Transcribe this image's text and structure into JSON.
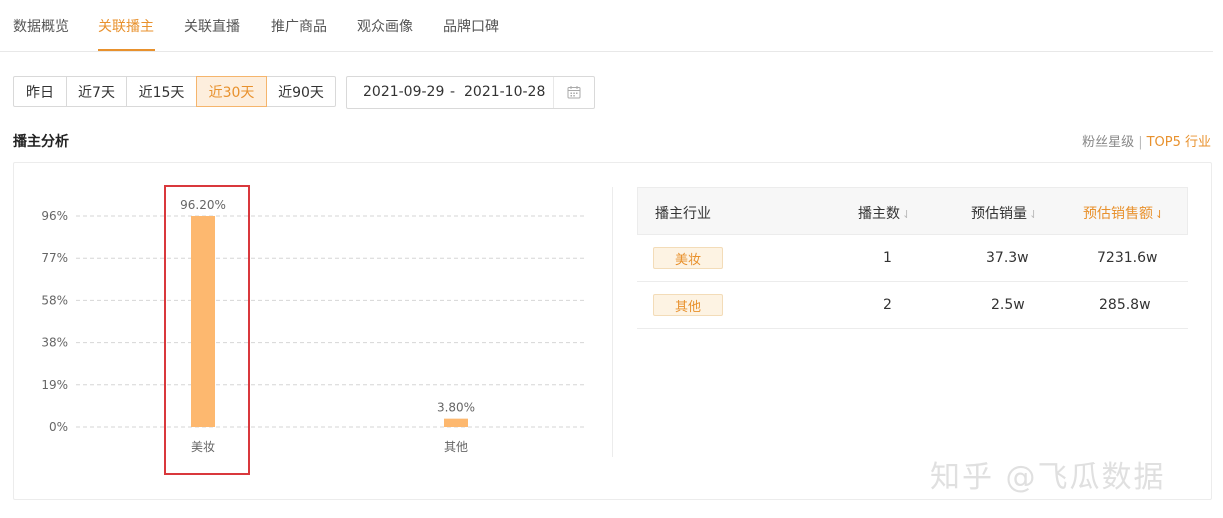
{
  "tabs": [
    {
      "label": "数据概览",
      "active": false
    },
    {
      "label": "关联播主",
      "active": true
    },
    {
      "label": "关联直播",
      "active": false
    },
    {
      "label": "推广商品",
      "active": false
    },
    {
      "label": "观众画像",
      "active": false
    },
    {
      "label": "品牌口碑",
      "active": false
    }
  ],
  "ranges": [
    {
      "label": "昨日",
      "active": false
    },
    {
      "label": "近7天",
      "active": false
    },
    {
      "label": "近15天",
      "active": false
    },
    {
      "label": "近30天",
      "active": true
    },
    {
      "label": "近90天",
      "active": false
    }
  ],
  "date_range": {
    "start": "2021-09-29",
    "separator": "-",
    "end": "2021-10-28"
  },
  "section": {
    "title": "播主分析",
    "link_muted": "粉丝星级",
    "link_sep": "|",
    "link_active": "TOP5 行业"
  },
  "chart_data": {
    "type": "bar",
    "categories": [
      "美妆",
      "其他"
    ],
    "values": [
      96.2,
      3.8
    ],
    "data_labels": [
      "96.20%",
      "3.80%"
    ],
    "y_ticks": [
      "96%",
      "77%",
      "58%",
      "38%",
      "19%",
      "0%"
    ],
    "ylim": [
      0,
      96
    ],
    "grid": true,
    "bar_color": "#fdb86f"
  },
  "table": {
    "headers": [
      "播主行业",
      "播主数",
      "预估销量",
      "预估销售额"
    ],
    "rows": [
      {
        "industry": "美妆",
        "count": "1",
        "volume": "37.3w",
        "sales": "7231.6w"
      },
      {
        "industry": "其他",
        "count": "2",
        "volume": "2.5w",
        "sales": "285.8w"
      }
    ]
  },
  "watermark": "知乎 @飞瓜数据",
  "colors": {
    "accent": "#e8912d",
    "highlight": "#d9383c"
  }
}
